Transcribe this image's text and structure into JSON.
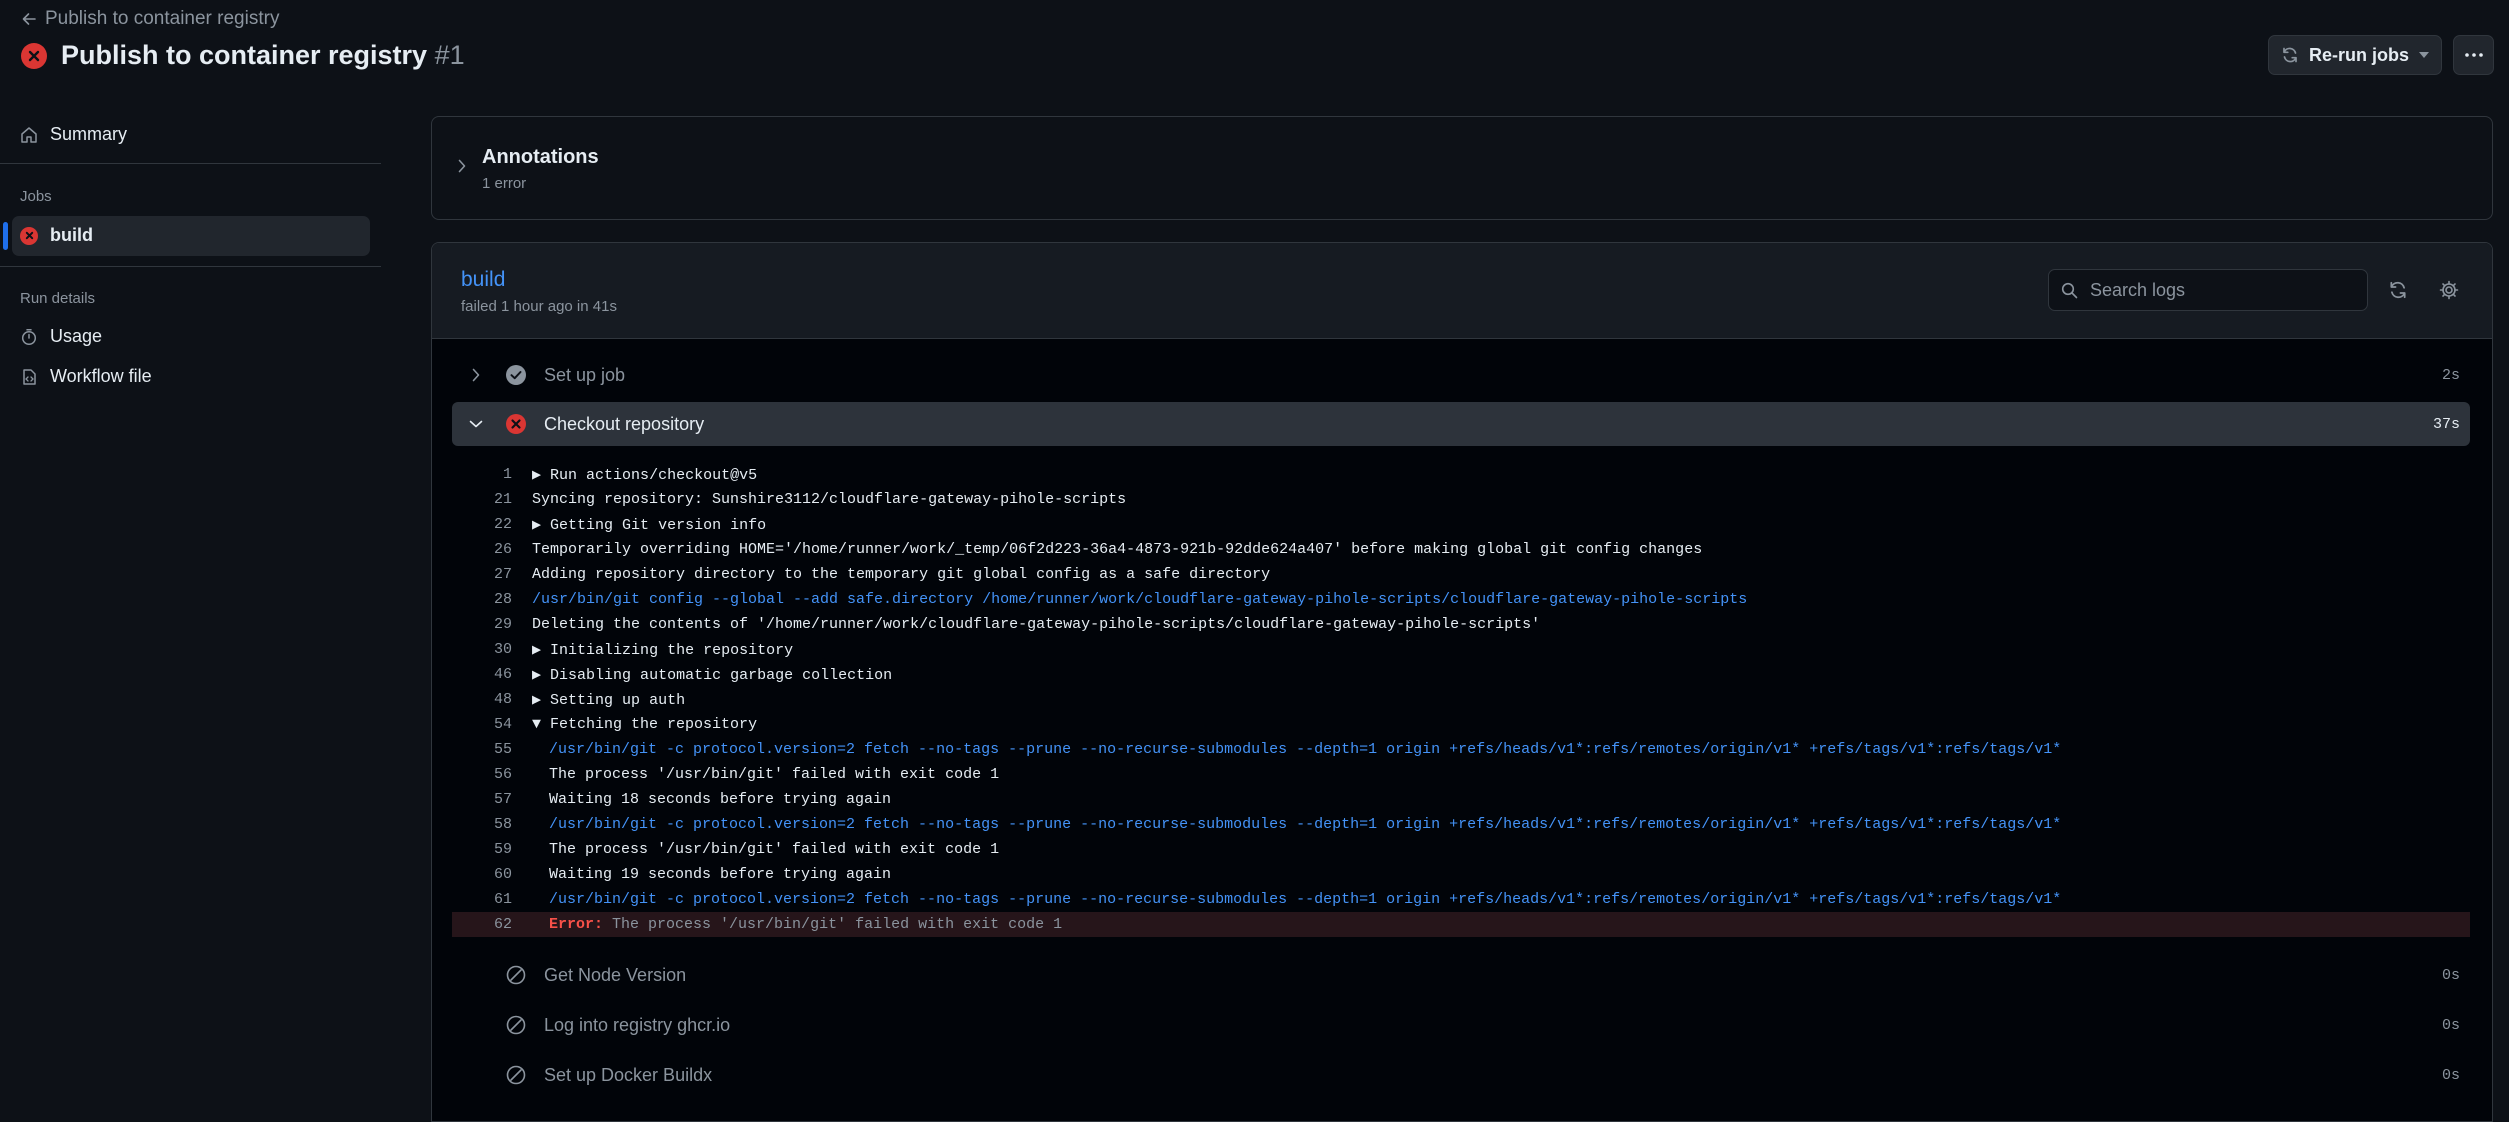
{
  "header": {
    "back_label": "Publish to container registry",
    "title": "Publish to container registry",
    "run_number": "#1",
    "rerun_label": "Re-run jobs"
  },
  "sidebar": {
    "summary_label": "Summary",
    "jobs_heading": "Jobs",
    "build_label": "build",
    "run_details_heading": "Run details",
    "usage_label": "Usage",
    "workflow_file_label": "Workflow file"
  },
  "annotations": {
    "title": "Annotations",
    "subtitle": "1 error"
  },
  "job": {
    "name": "build",
    "meta": "failed 1 hour ago in 41s",
    "search_placeholder": "Search logs"
  },
  "steps_before": [
    {
      "name": "Set up job",
      "duration": "2s",
      "status": "success"
    }
  ],
  "open_step": {
    "name": "Checkout repository",
    "duration": "37s",
    "status": "failure"
  },
  "log_lines": [
    {
      "n": "1",
      "text": "Run actions/checkout@v5",
      "marker": "▶",
      "kind": "normal"
    },
    {
      "n": "21",
      "text": "Syncing repository: Sunshire3112/cloudflare-gateway-pihole-scripts",
      "marker": "",
      "kind": "normal"
    },
    {
      "n": "22",
      "text": "Getting Git version info",
      "marker": "▶",
      "kind": "normal"
    },
    {
      "n": "26",
      "text": "Temporarily overriding HOME='/home/runner/work/_temp/06f2d223-36a4-4873-921b-92dde624a407' before making global git config changes",
      "marker": "",
      "kind": "normal"
    },
    {
      "n": "27",
      "text": "Adding repository directory to the temporary git global config as a safe directory",
      "marker": "",
      "kind": "normal"
    },
    {
      "n": "28",
      "text": "/usr/bin/git config --global --add safe.directory /home/runner/work/cloudflare-gateway-pihole-scripts/cloudflare-gateway-pihole-scripts",
      "marker": "",
      "kind": "cmd"
    },
    {
      "n": "29",
      "text": "Deleting the contents of '/home/runner/work/cloudflare-gateway-pihole-scripts/cloudflare-gateway-pihole-scripts'",
      "marker": "",
      "kind": "normal"
    },
    {
      "n": "30",
      "text": "Initializing the repository",
      "marker": "▶",
      "kind": "normal"
    },
    {
      "n": "46",
      "text": "Disabling automatic garbage collection",
      "marker": "▶",
      "kind": "normal"
    },
    {
      "n": "48",
      "text": "Setting up auth",
      "marker": "▶",
      "kind": "normal"
    },
    {
      "n": "54",
      "text": "Fetching the repository",
      "marker": "▼",
      "kind": "normal"
    },
    {
      "n": "55",
      "text": "/usr/bin/git -c protocol.version=2 fetch --no-tags --prune --no-recurse-submodules --depth=1 origin +refs/heads/v1*:refs/remotes/origin/v1* +refs/tags/v1*:refs/tags/v1*",
      "marker": "",
      "kind": "cmd",
      "indent": true
    },
    {
      "n": "56",
      "text": "The process '/usr/bin/git' failed with exit code 1",
      "marker": "",
      "kind": "normal",
      "indent": true
    },
    {
      "n": "57",
      "text": "Waiting 18 seconds before trying again",
      "marker": "",
      "kind": "normal",
      "indent": true
    },
    {
      "n": "58",
      "text": "/usr/bin/git -c protocol.version=2 fetch --no-tags --prune --no-recurse-submodules --depth=1 origin +refs/heads/v1*:refs/remotes/origin/v1* +refs/tags/v1*:refs/tags/v1*",
      "marker": "",
      "kind": "cmd",
      "indent": true
    },
    {
      "n": "59",
      "text": "The process '/usr/bin/git' failed with exit code 1",
      "marker": "",
      "kind": "normal",
      "indent": true
    },
    {
      "n": "60",
      "text": "Waiting 19 seconds before trying again",
      "marker": "",
      "kind": "normal",
      "indent": true
    },
    {
      "n": "61",
      "text": "/usr/bin/git -c protocol.version=2 fetch --no-tags --prune --no-recurse-submodules --depth=1 origin +refs/heads/v1*:refs/remotes/origin/v1* +refs/tags/v1*:refs/tags/v1*",
      "marker": "",
      "kind": "cmd",
      "indent": true
    },
    {
      "n": "62",
      "text": "The process '/usr/bin/git' failed with exit code 1",
      "marker": "",
      "kind": "err",
      "indent": true,
      "label": "Error:"
    }
  ],
  "steps_after": [
    {
      "name": "Get Node Version",
      "duration": "0s",
      "status": "skipped"
    },
    {
      "name": "Log into registry ghcr.io",
      "duration": "0s",
      "status": "skipped"
    },
    {
      "name": "Set up Docker Buildx",
      "duration": "0s",
      "status": "skipped"
    }
  ],
  "colors": {
    "bg": "#0d1117",
    "fail": "#da3633",
    "link": "#4493f8",
    "error_text": "#f85149",
    "muted": "#8b949e"
  }
}
